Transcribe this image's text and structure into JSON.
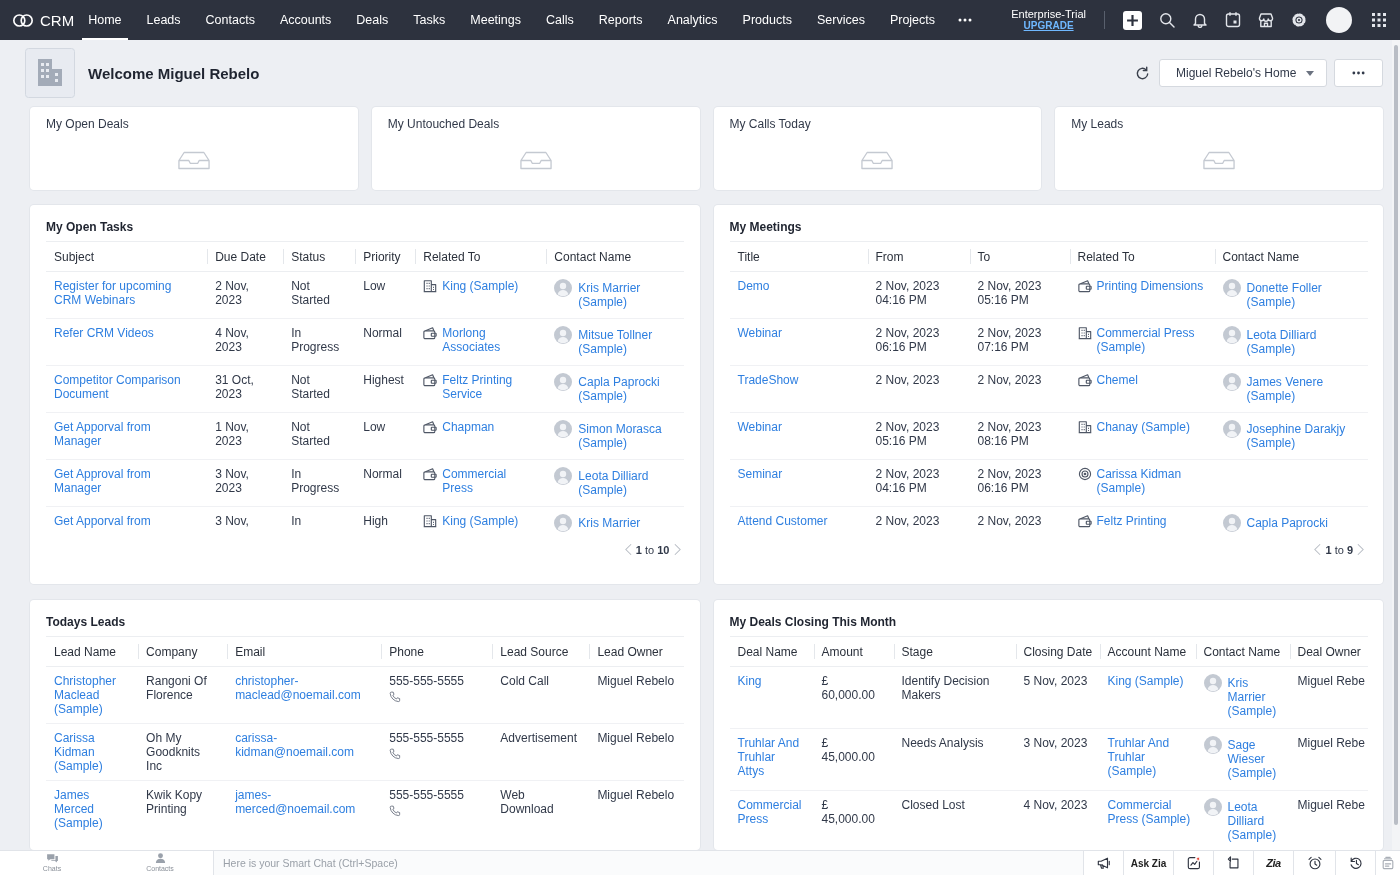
{
  "nav": {
    "brand": "CRM",
    "tabs": [
      {
        "label": "Home",
        "selected": true
      },
      {
        "label": "Leads",
        "selected": false
      },
      {
        "label": "Contacts",
        "selected": false
      },
      {
        "label": "Accounts",
        "selected": false
      },
      {
        "label": "Deals",
        "selected": false
      },
      {
        "label": "Tasks",
        "selected": false
      },
      {
        "label": "Meetings",
        "selected": false
      },
      {
        "label": "Calls",
        "selected": false
      },
      {
        "label": "Reports",
        "selected": false
      },
      {
        "label": "Analytics",
        "selected": false
      },
      {
        "label": "Products",
        "selected": false
      },
      {
        "label": "Services",
        "selected": false
      },
      {
        "label": "Projects",
        "selected": false
      }
    ],
    "plan": "Enterprise-Trial",
    "upgrade": "UPGRADE"
  },
  "header": {
    "title": "Welcome Miguel Rebelo",
    "home_selector": "Miguel Rebelo's Home"
  },
  "cards": [
    {
      "title": "My Open Deals"
    },
    {
      "title": "My Untouched Deals"
    },
    {
      "title": "My Calls Today"
    },
    {
      "title": "My Leads"
    }
  ],
  "open_tasks": {
    "title": "My Open Tasks",
    "columns": [
      "Subject",
      "Due Date",
      "Status",
      "Priority",
      "Related To",
      "Contact Name"
    ],
    "rows": [
      {
        "subject": "Register for upcoming CRM Webinars",
        "due_date": "2 Nov, 2023",
        "status": "Not Started",
        "priority": "Low",
        "related_to": {
          "kind": "account",
          "name": "King (Sample)"
        },
        "contact": "Kris Marrier (Sample)"
      },
      {
        "subject": "Refer CRM Videos",
        "due_date": "4 Nov, 2023",
        "status": "In Progress",
        "priority": "Normal",
        "related_to": {
          "kind": "deal",
          "name": "Morlong Associates"
        },
        "contact": "Mitsue Tollner (Sample)"
      },
      {
        "subject": "Competitor Comparison Document",
        "due_date": "31 Oct, 2023",
        "status": "Not Started",
        "priority": "Highest",
        "related_to": {
          "kind": "deal",
          "name": "Feltz Printing Service"
        },
        "contact": "Capla Paprocki (Sample)"
      },
      {
        "subject": "Get Apporval from Manager",
        "due_date": "1 Nov, 2023",
        "status": "Not Started",
        "priority": "Low",
        "related_to": {
          "kind": "deal",
          "name": "Chapman"
        },
        "contact": "Simon Morasca (Sample)"
      },
      {
        "subject": "Get Approval from Manager",
        "due_date": "3 Nov, 2023",
        "status": "In Progress",
        "priority": "Normal",
        "related_to": {
          "kind": "deal",
          "name": "Commercial Press"
        },
        "contact": "Leota Dilliard (Sample)"
      },
      {
        "subject": "Get Apporval from",
        "due_date": "3 Nov,",
        "status": "In",
        "priority": "High",
        "related_to": {
          "kind": "account",
          "name": "King (Sample)"
        },
        "contact": "Kris Marrier"
      }
    ],
    "pagination": "**1** to **10**"
  },
  "meetings": {
    "title": "My Meetings",
    "columns": [
      "Title",
      "From",
      "To",
      "Related To",
      "Contact Name"
    ],
    "rows": [
      {
        "title": "Demo",
        "from": "2 Nov, 2023 04:16 PM",
        "to": "2 Nov, 2023 05:16 PM",
        "related_to": {
          "kind": "deal",
          "name": "Printing Dimensions"
        },
        "contact": "Donette Foller (Sample)"
      },
      {
        "title": "Webinar",
        "from": "2 Nov, 2023 06:16 PM",
        "to": "2 Nov, 2023 07:16 PM",
        "related_to": {
          "kind": "account",
          "name": "Commercial Press (Sample)"
        },
        "contact": "Leota Dilliard (Sample)"
      },
      {
        "title": "TradeShow",
        "from": "2 Nov, 2023",
        "to": "2 Nov, 2023",
        "related_to": {
          "kind": "deal",
          "name": "Chemel"
        },
        "contact": "James Venere (Sample)"
      },
      {
        "title": "Webinar",
        "from": "2 Nov, 2023 05:16 PM",
        "to": "2 Nov, 2023 08:16 PM",
        "related_to": {
          "kind": "account",
          "name": "Chanay (Sample)"
        },
        "contact": "Josephine Darakjy (Sample)"
      },
      {
        "title": "Seminar",
        "from": "2 Nov, 2023 04:16 PM",
        "to": "2 Nov, 2023 06:16 PM",
        "related_to": {
          "kind": "lead",
          "name": "Carissa Kidman (Sample)"
        }
      },
      {
        "title": "Attend Customer",
        "from": "2 Nov, 2023",
        "to": "2 Nov, 2023",
        "related_to": {
          "kind": "deal",
          "name": "Feltz Printing"
        },
        "contact": "Capla Paprocki"
      }
    ],
    "pagination": "**1** to **9**"
  },
  "todays_leads": {
    "title": "Todays Leads",
    "columns": [
      "Lead Name",
      "Company",
      "Email",
      "Phone",
      "Lead Source",
      "Lead Owner"
    ],
    "rows": [
      {
        "lead_name": "Christopher Maclead (Sample)",
        "company": "Rangoni Of Florence",
        "email": "christopher-maclead@noemail.com",
        "phone": "555-555-5555",
        "lead_source": "Cold Call",
        "lead_owner": "Miguel Rebelo"
      },
      {
        "lead_name": "Carissa Kidman (Sample)",
        "company": "Oh My Goodknits Inc",
        "email": "carissa-kidman@noemail.com",
        "phone": "555-555-5555",
        "lead_source": "Advertisement",
        "lead_owner": "Miguel Rebelo"
      },
      {
        "lead_name": "James Merced (Sample)",
        "company": "Kwik Kopy Printing",
        "email": "james-merced@noemail.com",
        "phone": "555-555-5555",
        "lead_source": "Web Download",
        "lead_owner": "Miguel Rebelo"
      }
    ]
  },
  "deals_closing": {
    "title": "My Deals Closing This Month",
    "columns": [
      "Deal Name",
      "Amount",
      "Stage",
      "Closing Date",
      "Account Name",
      "Contact Name",
      "Deal Owner"
    ],
    "rows": [
      {
        "deal_name": "King",
        "amount": "£ 60,000.00",
        "stage": "Identify Decision Makers",
        "closing_date": "5 Nov, 2023",
        "account_name": "King (Sample)",
        "contact": "Kris Marrier (Sample)",
        "deal_owner": "Miguel Rebe"
      },
      {
        "deal_name": "Truhlar And Truhlar Attys",
        "amount": "£ 45,000.00",
        "stage": "Needs Analysis",
        "closing_date": "3 Nov, 2023",
        "account_name": "Truhlar And Truhlar (Sample)",
        "contact": "Sage Wieser (Sample)",
        "deal_owner": "Miguel Rebe"
      },
      {
        "deal_name": "Commercial Press",
        "amount": "£ 45,000.00",
        "stage": "Closed Lost",
        "closing_date": "4 Nov, 2023",
        "account_name": "Commercial Press (Sample)",
        "contact": "Leota Dilliard (Sample)",
        "deal_owner": "Miguel Rebe"
      }
    ]
  },
  "chat_bar": {
    "tabs": [
      "Chats",
      "Contacts"
    ],
    "placeholder": "Here is your Smart Chat (Ctrl+Space)",
    "ask_zia": "Ask Zia",
    "zia": "Zia"
  }
}
